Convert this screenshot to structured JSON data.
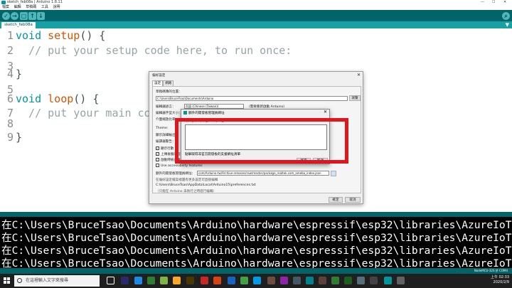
{
  "window": {
    "title": "sketch_feb08a | Arduino 1.8.11",
    "controls": [
      "—",
      "☐",
      "✕"
    ]
  },
  "menu": [
    "檔案",
    "編輯",
    "草稿碼",
    "工具",
    "說明"
  ],
  "toolbar": {
    "verify": "✓",
    "upload": "→",
    "new": "▢",
    "open": "↑",
    "save": "↓",
    "serial": "⌕"
  },
  "tab": {
    "name": "sketch_feb08a",
    "dropdown": "▼"
  },
  "editor": {
    "lines": [
      {
        "n": "1",
        "text": "void setup() {"
      },
      {
        "n": "2",
        "text": "  // put your setup code here, to run once:"
      },
      {
        "n": "3",
        "text": ""
      },
      {
        "n": "4",
        "text": "}"
      },
      {
        "n": "5",
        "text": ""
      },
      {
        "n": "6",
        "text": "void loop() {"
      },
      {
        "n": "7",
        "text": "  // put your main code"
      },
      {
        "n": "8",
        "text": ""
      },
      {
        "n": "9",
        "text": "}"
      }
    ]
  },
  "console": {
    "lines": [
      "在C:\\Users\\BruceTsao\\Documents\\Arduino\\hardware\\espressif\\esp32\\libraries\\AzureIoT: no head",
      "在C:\\Users\\BruceTsao\\Documents\\Arduino\\hardware\\espressif\\esp32\\libraries\\AzureIoT: no head",
      "在C:\\Users\\BruceTsao\\Documents\\Arduino\\hardware\\espressif\\esp32\\libraries\\AzureIoT: no head",
      "在C:\\Users\\BruceTsao\\Documents\\Arduino\\hardware\\espressif\\esp32\\libraries\\AzureIoT: no head"
    ]
  },
  "status": {
    "board": "NodeMCU-32S 於 COM4"
  },
  "preferences": {
    "title": "偏好設定",
    "close": "✕",
    "tabs": [
      "設定",
      "網路"
    ],
    "sketchbook_label": "草稿碼簿的位置：",
    "sketchbook_path": "C:\\Users\\BruceTsao\\Documents\\Arduino",
    "browse": "瀏覽",
    "language_label": "編輯器語言：",
    "language_value": "台語 (Chinese (Taiwan))",
    "language_note": "（需要重新啟動 Arduino）",
    "fontsize_label": "編輯器字型大小：",
    "scale_label": "介面縮放比率：",
    "theme_label": "Theme:",
    "verbose_label": "顯示詳細輸出：",
    "warnings_label": "編譯器警告：",
    "checks": [
      "顯示行數",
      "上傳後驗證程式碼",
      "啟動時檢查更新",
      "Use accessibility features"
    ],
    "boards_label": "額外的開發板管理員網址：",
    "boards_url": "com/Arduino-tw/Archive-releases/raw/master/package_realtek.com_ameba_index.json",
    "more_label": "在偏好設定檔案裡還有更多設定可直接編輯",
    "prefs_path": "C:\\Users\\BruceTsao\\AppData\\Local\\Arduino15\\preferences.txt",
    "edit_note": "（只能在 Arduino 未執行之時進行編輯）",
    "ok": "確定",
    "cancel": "取消"
  },
  "urls_dialog": {
    "title": "額外的開發板管理員網址",
    "close": "✕",
    "hint": "輸入額外的網址，一行一個",
    "link": "點擊取得非官方開發板的支援網址清單",
    "ok": "確定",
    "cancel": "取消"
  },
  "taskbar": {
    "search_placeholder": "在這裡輸入文字來搜尋",
    "time": "上午 02:33",
    "date": "2020/2/9"
  },
  "colors": {
    "arduino_teal": "#00979c",
    "toolbar": "#006468",
    "highlight": "#e0151d"
  }
}
